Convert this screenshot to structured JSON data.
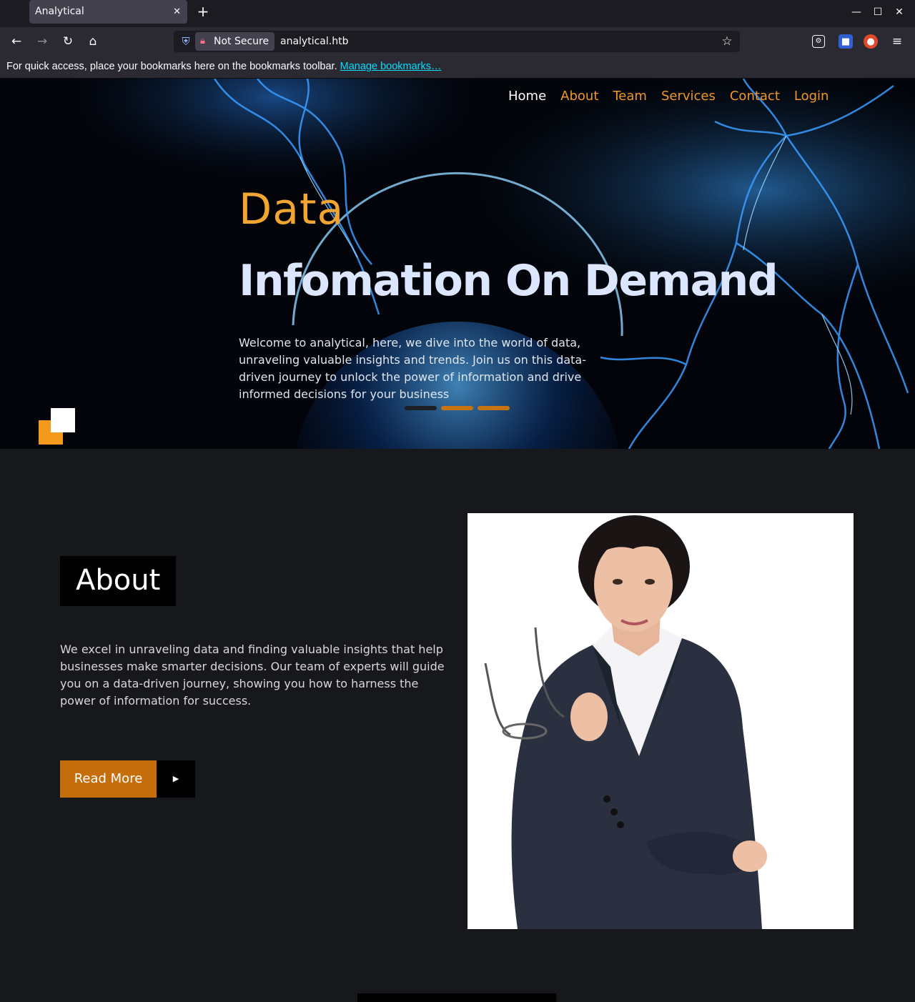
{
  "browser": {
    "tab_title": "Analytical",
    "tab_close": "✕",
    "new_tab": "+",
    "window_controls": {
      "minimize": "—",
      "maximize": "☐",
      "close": "✕"
    },
    "nav": {
      "back": "←",
      "forward": "→",
      "reload": "↻",
      "home": "⌂"
    },
    "security_label": "Not Secure",
    "url": "analytical.htb",
    "bookmark_star": "☆",
    "menu": "≡",
    "bookmarks_bar_text": "For quick access, place your bookmarks here on the bookmarks toolbar.",
    "manage_bookmarks": "Manage bookmarks…"
  },
  "site": {
    "menu": [
      {
        "label": "Home",
        "active": true
      },
      {
        "label": "About",
        "active": false
      },
      {
        "label": "Team",
        "active": false
      },
      {
        "label": "Services",
        "active": false
      },
      {
        "label": "Contact",
        "active": false
      },
      {
        "label": "Login",
        "active": false
      }
    ],
    "hero": {
      "kicker": "Data",
      "title": "Infomation On Demand",
      "description": "Welcome to analytical, here, we dive into the world of data, unraveling valuable insights and trends. Join us on this data-driven journey to unlock the power of information and drive informed decisions for your business",
      "slider_dots": [
        {
          "color": "#1d1f24",
          "active": false
        },
        {
          "color": "#c87311",
          "active": true
        },
        {
          "color": "#c87311",
          "active": false
        }
      ]
    },
    "about": {
      "title": "About",
      "text": "We excel in unraveling data and finding valuable insights that help businesses make smarter decisions. Our team of experts will guide you on a data-driven journey, showing you how to harness the power of information for success.",
      "button_label": "Read More",
      "button_arrow": "▶"
    }
  },
  "colors": {
    "accent_orange": "#f2a531",
    "button_orange": "#c66e0c",
    "page_bg": "#17181c",
    "title_blue": "#dce6ff"
  }
}
